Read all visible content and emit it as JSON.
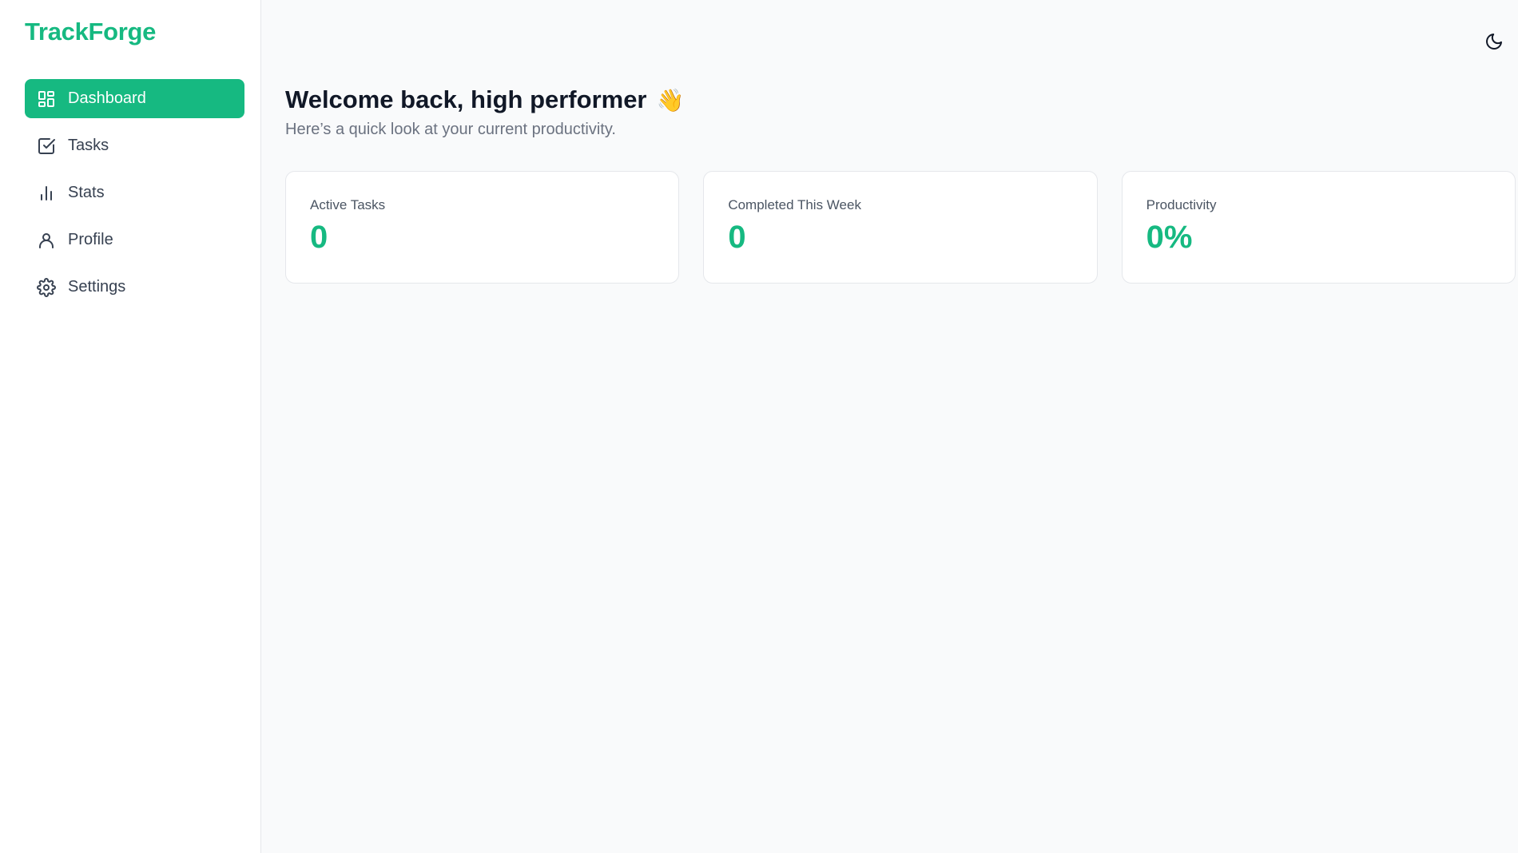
{
  "brand": {
    "name": "TrackForge"
  },
  "colors": {
    "accent": "#16b981",
    "text_primary": "#111827",
    "text_muted": "#6b7280",
    "background": "#f9fafb",
    "surface": "#ffffff"
  },
  "sidebar": {
    "items": [
      {
        "label": "Dashboard",
        "icon": "dashboard-grid-icon",
        "active": true
      },
      {
        "label": "Tasks",
        "icon": "check-square-icon",
        "active": false
      },
      {
        "label": "Stats",
        "icon": "bar-chart-icon",
        "active": false
      },
      {
        "label": "Profile",
        "icon": "user-icon",
        "active": false
      },
      {
        "label": "Settings",
        "icon": "gear-icon",
        "active": false
      }
    ]
  },
  "header": {
    "theme_toggle_icon": "moon-icon"
  },
  "main": {
    "title": "Welcome back, high performer",
    "title_emoji": "👋",
    "subtitle": "Here’s a quick look at your current productivity.",
    "cards": [
      {
        "label": "Active Tasks",
        "value": "0"
      },
      {
        "label": "Completed This Week",
        "value": "0"
      },
      {
        "label": "Productivity",
        "value": "0%"
      }
    ]
  }
}
